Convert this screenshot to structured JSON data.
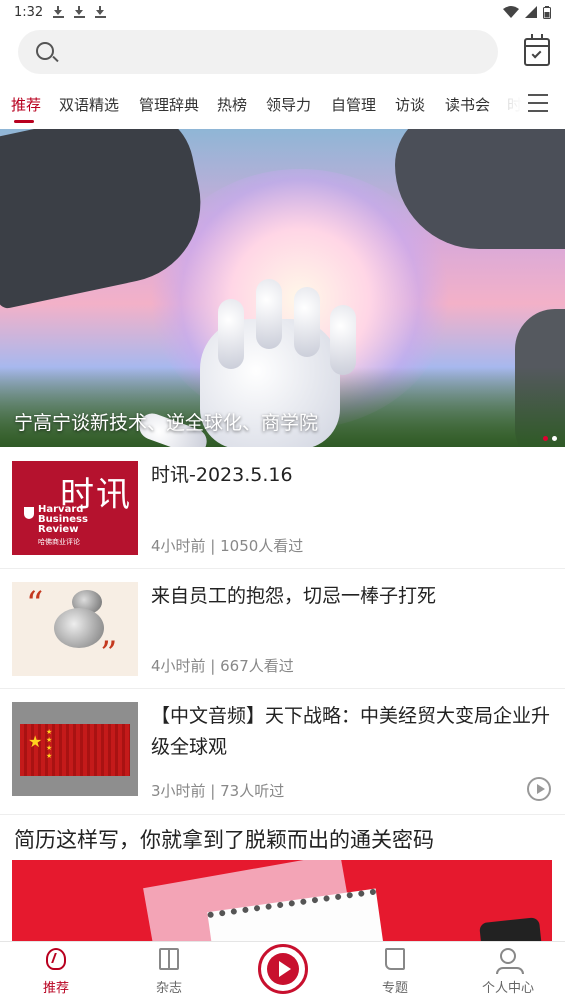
{
  "status_bar": {
    "time": "1:32"
  },
  "search": {
    "placeholder": ""
  },
  "tabs": [
    {
      "label": "推荐"
    },
    {
      "label": "双语精选"
    },
    {
      "label": "管理辞典"
    },
    {
      "label": "热榜"
    },
    {
      "label": "领导力"
    },
    {
      "label": "自管理"
    },
    {
      "label": "访谈"
    },
    {
      "label": "读书会"
    },
    {
      "label": "时"
    }
  ],
  "banner": {
    "caption": "宁高宁谈新技术、逆全球化、商学院",
    "active_slide": 1,
    "slide_count": 2
  },
  "articles": [
    {
      "title": "时讯-2023.5.16",
      "meta": "4小时前 | 1050人看过",
      "thumb": {
        "big": "时讯",
        "brand": "Harvard Business Review",
        "sub": "哈佛商业评论"
      }
    },
    {
      "title": "来自员工的抱怨，切忌一棒子打死",
      "meta": "4小时前 | 667人看过",
      "thumb": {
        "q1": "“",
        "q2": "”"
      }
    },
    {
      "title": "【中文音频】天下战略：中美经贸大变局企业升级全球观",
      "meta": "3小时前 | 73人听过"
    }
  ],
  "featured": {
    "title": "简历这样写，你就拿到了脱颖而出的通关密码"
  },
  "bottom_nav": [
    {
      "label": "推荐"
    },
    {
      "label": "杂志"
    },
    {
      "label": "专题"
    },
    {
      "label": "个人中心"
    }
  ],
  "colors": {
    "accent": "#b8001f",
    "hbr_red": "#b5122e"
  }
}
